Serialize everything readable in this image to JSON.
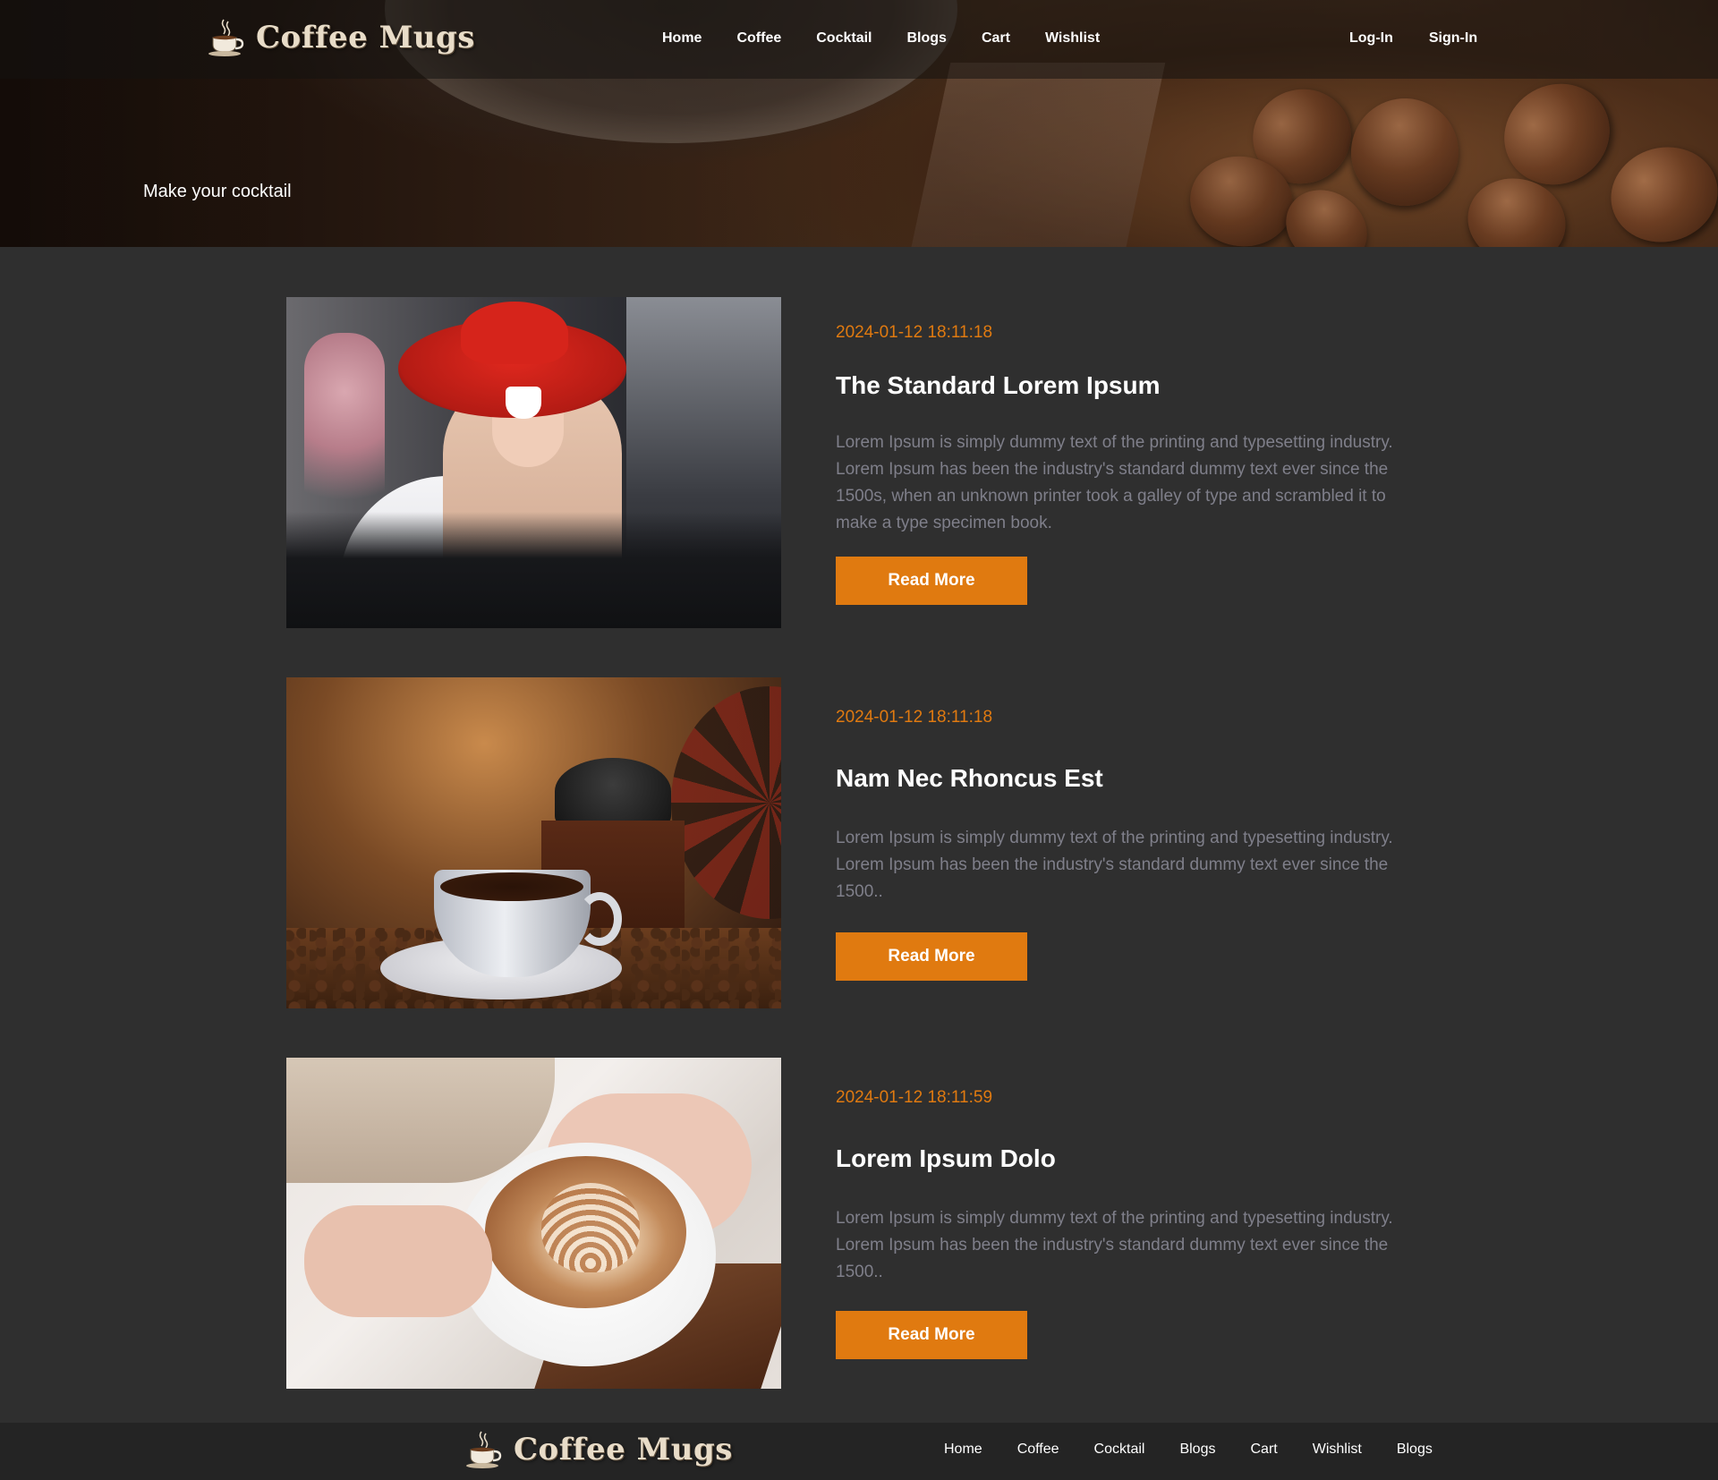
{
  "brand": {
    "name": "Coffee Mugs"
  },
  "nav": {
    "links": [
      "Home",
      "Coffee",
      "Cocktail",
      "Blogs",
      "Cart",
      "Wishlist"
    ],
    "login": "Log-In",
    "signin": "Sign-In"
  },
  "hero": {
    "title": "Make your cocktail"
  },
  "posts": [
    {
      "date": "2024-01-12 18:11:18",
      "title": "The Standard Lorem Ipsum",
      "excerpt": "Lorem Ipsum is simply dummy text of the printing and typesetting industry. Lorem Ipsum has been the industry's standard dummy text ever since the 1500s, when an unknown printer took a galley of type and scrambled it to make a type specimen book.",
      "button": "Read More"
    },
    {
      "date": "2024-01-12 18:11:18",
      "title": "Nam Nec Rhoncus Est",
      "excerpt": "Lorem Ipsum is simply dummy text of the printing and typesetting industry. Lorem Ipsum has been the industry's standard dummy text ever since the 1500..",
      "button": "Read More"
    },
    {
      "date": "2024-01-12 18:11:59",
      "title": "Lorem Ipsum Dolo",
      "excerpt": "Lorem Ipsum is simply dummy text of the printing and typesetting industry. Lorem Ipsum has been the industry's standard dummy text ever since the 1500..",
      "button": "Read More"
    }
  ],
  "footer": {
    "links": [
      "Home",
      "Coffee",
      "Cocktail",
      "Blogs",
      "Cart",
      "Wishlist",
      "Blogs"
    ]
  },
  "colors": {
    "accent": "#e07a10",
    "background": "#2f2f2f",
    "footer": "#242424",
    "excerpt_text": "#7f7f8a"
  },
  "icons": {
    "logo": "coffee-cup-icon"
  }
}
